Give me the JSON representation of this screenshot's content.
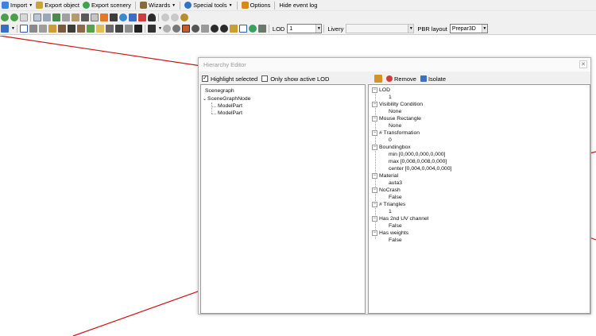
{
  "menu": {
    "import": "Import",
    "export_object": "Export object",
    "export_scenery": "Export scenery",
    "wizards": "Wizards",
    "special_tools": "Special tools",
    "options": "Options",
    "hide_event_log": "Hide event log"
  },
  "toolbar2": {
    "lod_label": "LOD",
    "lod_value": "1",
    "livery_label": "Livery",
    "livery_value": "",
    "pbr_label": "PBR layout",
    "pbr_value": "Prepar3D"
  },
  "colors": {
    "viewport_line": "#cc1111",
    "accent_blue": "#1e64c8"
  },
  "hierarchy": {
    "title": "Hierarchy Editor",
    "highlight_selected": "Highlight selected",
    "highlight_checked": true,
    "only_active_lod": "Only show active LOD",
    "only_active_lod_checked": false,
    "remove": "Remove",
    "isolate": "Isolate",
    "scenegraph_header": "Scenegraph",
    "scenegraph_root": "SceneGraphNode",
    "model_parts": [
      "ModelPart",
      "ModelPart"
    ]
  },
  "properties": {
    "lod": "LOD",
    "lod_value": "1",
    "visibility": "Visibility Condition",
    "visibility_value": "None",
    "mouse_rect": "Mouse Rectangle",
    "mouse_rect_value": "None",
    "transformation": "# Transformation",
    "transformation_value": "0",
    "boundingbox": "Boundingbox",
    "bbox_min": "min [0,000,0,000,0,000]",
    "bbox_max": "max [0,008,0,008,0,000]",
    "bbox_center": "center [0,004,0,004,0,000]",
    "material": "Material",
    "material_value": "auta3",
    "nocrash": "NoCrash",
    "nocrash_value": "False",
    "triangles": "# Triangles",
    "triangles_value": "1",
    "has_2nd_uv": "Has 2nd UV channel",
    "has_2nd_uv_value": "False",
    "has_weights": "Has weights",
    "has_weights_value": "False"
  }
}
